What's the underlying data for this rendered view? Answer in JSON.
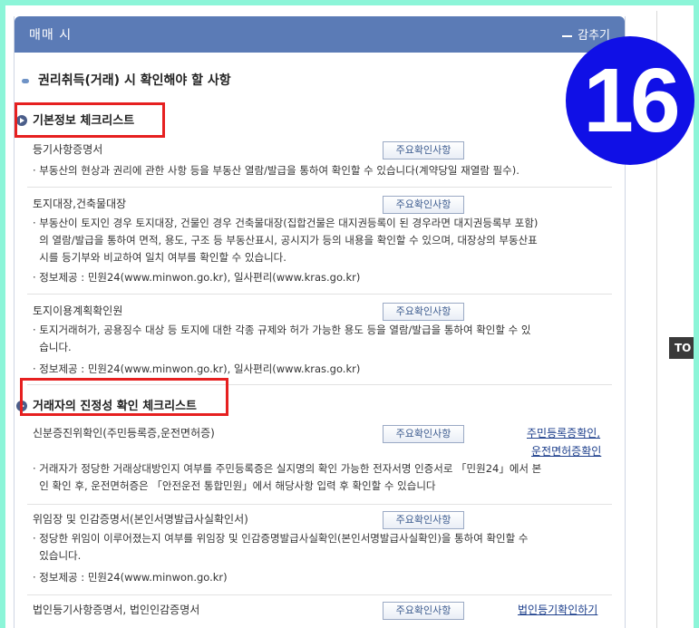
{
  "panel": {
    "title": "매매 시",
    "toggle_label": "감추기"
  },
  "section": {
    "title": "권리취득(거래) 시 확인해야 할 사항"
  },
  "subheadings": {
    "basic": "기본정보 체크리스트",
    "authenticity": "거래자의 진정성 확인 체크리스트"
  },
  "button_label": "주요확인사항",
  "items": [
    {
      "title": "등기사항증명서",
      "lines": [
        "· 부동산의 현상과 권리에 관한 사항 등을 부동산 열람/발급을 통하여 확인할 수 있습니다(계약당일 재열람 필수)."
      ]
    },
    {
      "title": "토지대장,건축물대장",
      "lines": [
        "· 부동산이 토지인 경우 토지대장, 건물인 경우 건축물대장(집합건물은 대지권등록이 된 경우라면 대지권등록부 포함)",
        "  의 열람/발급을 통하여 면적, 용도, 구조 등 부동산표시, 공시지가 등의 내용을 확인할 수 있으며, 대장상의 부동산표",
        "  시를 등기부와 비교하여 일치 여부를 확인할 수 있습니다."
      ],
      "info": "· 정보제공 : 민원24(www.minwon.go.kr), 일사편리(www.kras.go.kr)"
    },
    {
      "title": "토지이용계획확인원",
      "lines": [
        "· 토지거래허가, 공용징수 대상 등 토지에 대한 각종 규제와 허가 가능한 용도 등을 열람/발급을 통하여 확인할 수 있",
        "  습니다."
      ],
      "info": "· 정보제공 : 민원24(www.minwon.go.kr), 일사편리(www.kras.go.kr)"
    },
    {
      "title": "신분증진위확인(주민등록증,운전면허증)",
      "links": [
        "주민등록증확인,",
        "운전면허증확인"
      ],
      "lines": [
        "· 거래자가 정당한 거래상대방인지 여부를 주민등록증은 실지명의 확인 가능한 전자서명 인증서로 「민원24」에서 본",
        "  인 확인 후, 운전면허증은 「안전운전 통합민원」에서 해당사항 입력 후 확인할 수 있습니다"
      ]
    },
    {
      "title": "위임장 및 인감증명서(본인서명발급사실확인서)",
      "lines": [
        "· 정당한 위임이 이루어졌는지 여부를 위임장 및 인감증명발급사실확인(본인서명발급사실확인)을 통하여 확인할 수",
        "  있습니다."
      ],
      "info": "· 정보제공 : 민원24(www.minwon.go.kr)"
    },
    {
      "title": "법인등기사항증명서, 법인인감증명서",
      "links": [
        "법인등기확인하기"
      ]
    }
  ],
  "badge": "16",
  "top_tab": "TO"
}
